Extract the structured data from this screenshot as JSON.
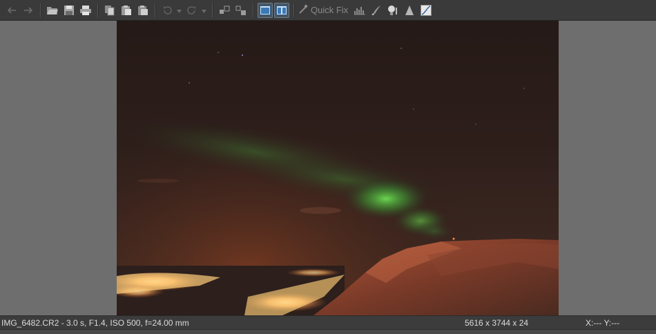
{
  "toolbar": {
    "buttons": [
      {
        "name": "undo-arrow-icon"
      },
      {
        "name": "redo-arrow-icon"
      },
      {
        "name": "open-folder-icon"
      },
      {
        "name": "save-icon"
      },
      {
        "name": "print-icon"
      },
      {
        "name": "copy-icon"
      },
      {
        "name": "paste-icon"
      },
      {
        "name": "paste-special-icon"
      },
      {
        "name": "rotate-left-icon"
      },
      {
        "name": "rotate-right-icon"
      },
      {
        "name": "zoom-fit-icon"
      },
      {
        "name": "zoom-actual-icon"
      },
      {
        "name": "view-single-icon"
      },
      {
        "name": "view-compare-icon"
      },
      {
        "name": "quick-fix-icon"
      },
      {
        "name": "histogram-icon"
      },
      {
        "name": "brush-icon"
      },
      {
        "name": "light-bulb-icon"
      },
      {
        "name": "sharpen-triangle-icon"
      },
      {
        "name": "curves-icon"
      }
    ],
    "quick_fix_label": "Quick Fix"
  },
  "status": {
    "file_info": "IMG_6482.CR2 - 3.0 s, F1.4, ISO 500, f=24.00 mm",
    "dimensions": "5616 x 3744 x 24",
    "coordinates": "X:---   Y:---"
  },
  "colors": {
    "toolbar_bg": "#3a3a3a",
    "canvas_bg": "#6e6e6e",
    "statusbar_bg": "#3c3c3c",
    "aurora_green": "#5fd64a",
    "city_lights": "#ffd27a"
  }
}
